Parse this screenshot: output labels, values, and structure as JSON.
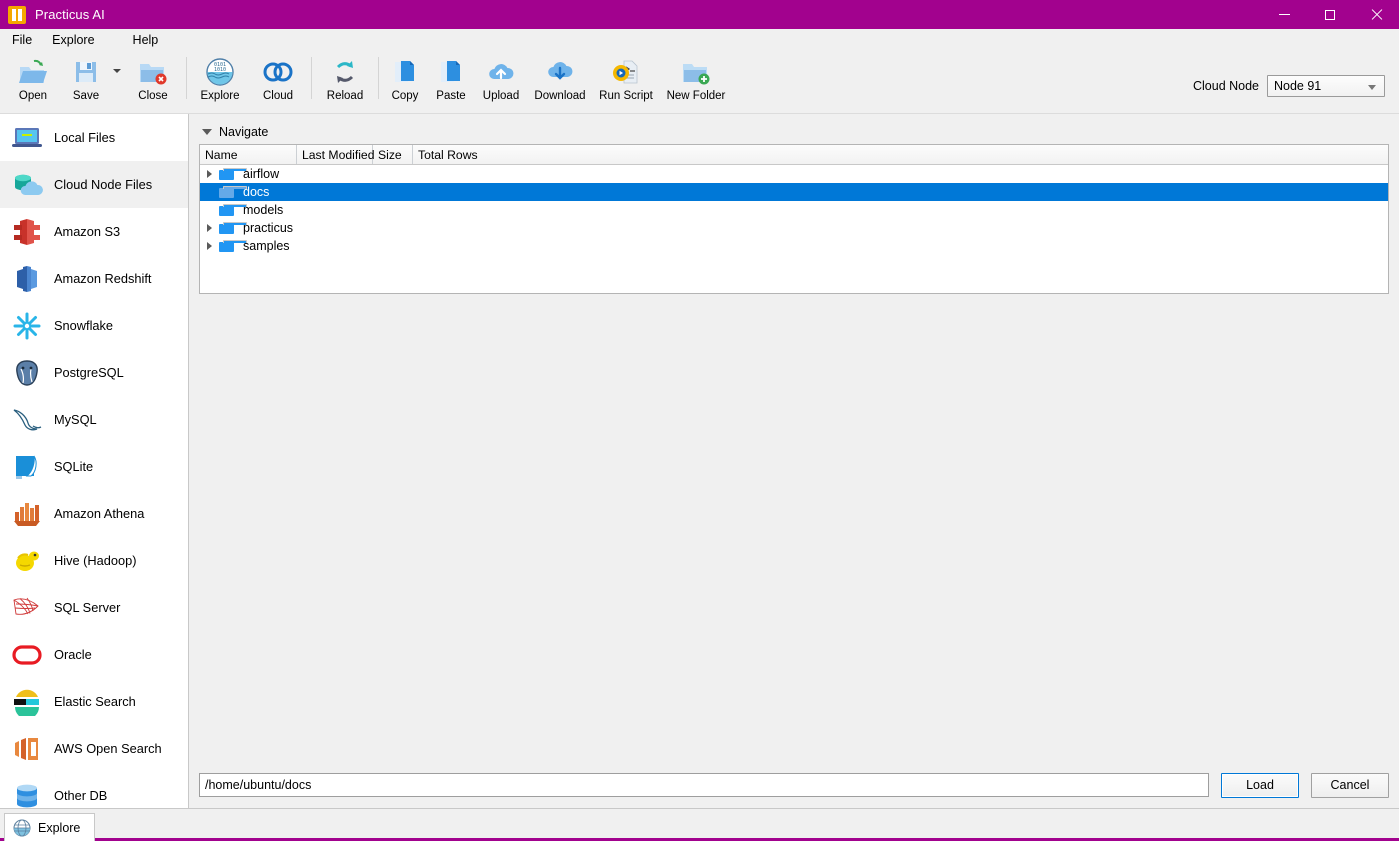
{
  "window": {
    "title": "Practicus AI",
    "app_icon": "practicus-logo-icon",
    "minimize_label": "—",
    "maximize_label": "□",
    "close_label": "✕",
    "titlebar_color": "#a2028e"
  },
  "menubar": {
    "items": [
      {
        "label": "File",
        "name": "menu-file"
      },
      {
        "label": "Explore",
        "name": "menu-explore"
      },
      {
        "label": "Help",
        "name": "menu-help"
      }
    ]
  },
  "toolbar": {
    "buttons": [
      {
        "label": "Open",
        "icon": "open-folder-icon"
      },
      {
        "label": "Save",
        "icon": "save-disk-icon"
      },
      {
        "label": "Close",
        "icon": "close-folder-icon"
      },
      {
        "label": "Explore",
        "icon": "explore-globe-icon"
      },
      {
        "label": "Cloud",
        "icon": "cloud-infinity-icon"
      },
      {
        "label": "Reload",
        "icon": "reload-arrows-icon"
      },
      {
        "label": "Copy",
        "icon": "copy-pages-icon"
      },
      {
        "label": "Paste",
        "icon": "paste-pages-icon"
      },
      {
        "label": "Upload",
        "icon": "cloud-upload-icon"
      },
      {
        "label": "Download",
        "icon": "cloud-download-icon"
      },
      {
        "label": "Run Script",
        "icon": "run-script-gear-icon"
      },
      {
        "label": "New Folder",
        "icon": "new-folder-plus-icon"
      }
    ],
    "save_dropdown_icon": "chevron-down-icon",
    "cloud_node": {
      "label": "Cloud Node",
      "selected": "Node 91",
      "caret_icon": "chevron-down-icon"
    }
  },
  "sidebar": {
    "selected_index": 1,
    "items": [
      {
        "label": "Local Files",
        "icon": "laptop-icon"
      },
      {
        "label": "Cloud Node Files",
        "icon": "cloud-database-icon"
      },
      {
        "label": "Amazon S3",
        "icon": "amazon-s3-icon"
      },
      {
        "label": "Amazon Redshift",
        "icon": "amazon-redshift-icon"
      },
      {
        "label": "Snowflake",
        "icon": "snowflake-icon"
      },
      {
        "label": "PostgreSQL",
        "icon": "postgresql-elephant-icon"
      },
      {
        "label": "MySQL",
        "icon": "mysql-dolphin-icon"
      },
      {
        "label": "SQLite",
        "icon": "sqlite-icon"
      },
      {
        "label": "Amazon Athena",
        "icon": "amazon-athena-icon"
      },
      {
        "label": "Hive (Hadoop)",
        "icon": "hive-hadoop-bee-icon"
      },
      {
        "label": "SQL Server",
        "icon": "sql-server-icon"
      },
      {
        "label": "Oracle",
        "icon": "oracle-icon"
      },
      {
        "label": "Elastic Search",
        "icon": "elastic-search-icon"
      },
      {
        "label": "AWS Open Search",
        "icon": "aws-open-search-icon"
      },
      {
        "label": "Other DB",
        "icon": "database-cylinder-icon"
      }
    ]
  },
  "main": {
    "navigate_label": "Navigate",
    "navigate_caret_icon": "caret-down-icon",
    "columns": [
      "Name",
      "Last Modified",
      "Size",
      "Total Rows"
    ],
    "rows": [
      {
        "name": "airflow",
        "expandable": true,
        "selected": false,
        "last_modified": "",
        "size": "",
        "total_rows": ""
      },
      {
        "name": "docs",
        "expandable": false,
        "selected": true,
        "last_modified": "",
        "size": "",
        "total_rows": ""
      },
      {
        "name": "models",
        "expandable": false,
        "selected": false,
        "last_modified": "",
        "size": "",
        "total_rows": ""
      },
      {
        "name": "practicus",
        "expandable": true,
        "selected": false,
        "last_modified": "",
        "size": "",
        "total_rows": ""
      },
      {
        "name": "samples",
        "expandable": true,
        "selected": false,
        "last_modified": "",
        "size": "",
        "total_rows": ""
      }
    ],
    "selection_color": "#0078d7"
  },
  "footer": {
    "path_value": "/home/ubuntu/docs",
    "path_placeholder": "",
    "load_label": "Load",
    "cancel_label": "Cancel"
  },
  "tabstrip": {
    "tabs": [
      {
        "label": "Explore",
        "icon": "globe-icon",
        "active": true
      }
    ],
    "accent_color": "#a2028e"
  }
}
